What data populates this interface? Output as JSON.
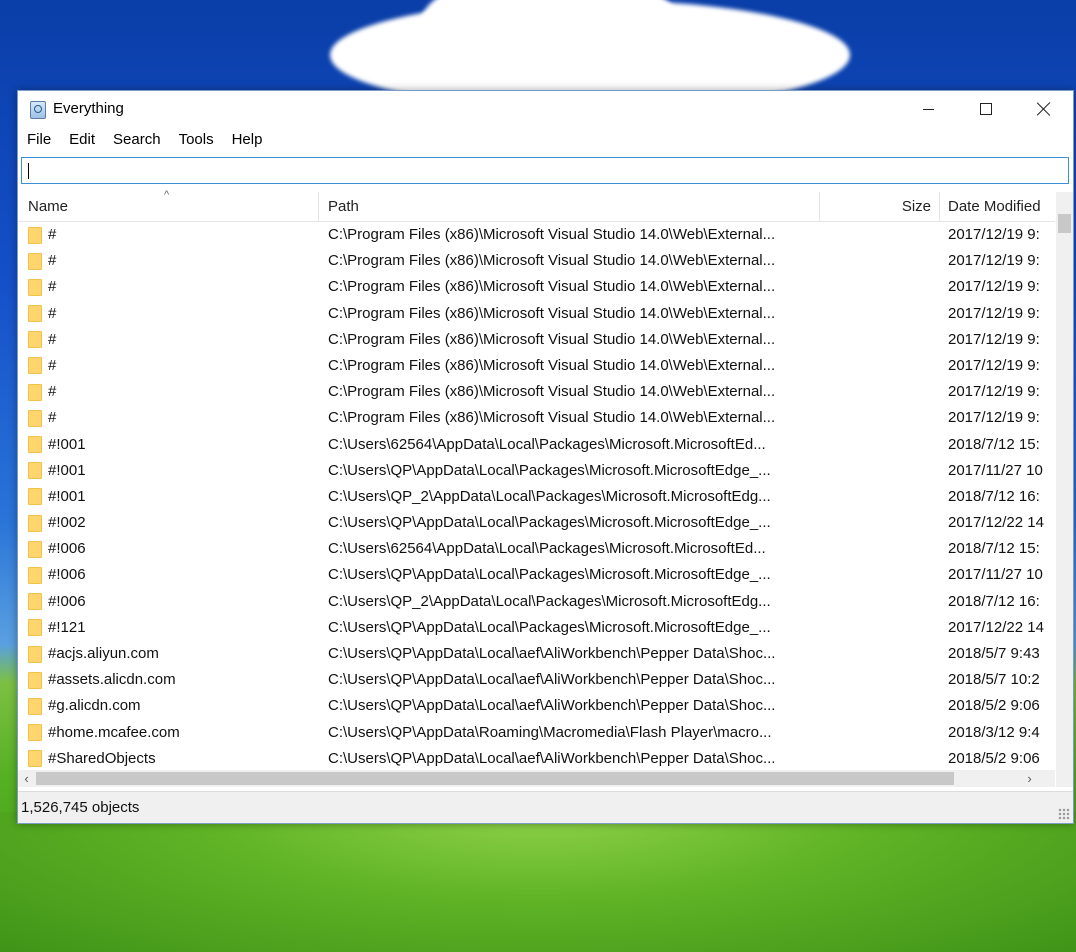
{
  "window": {
    "title": "Everything"
  },
  "menu": [
    "File",
    "Edit",
    "Search",
    "Tools",
    "Help"
  ],
  "search": {
    "value": ""
  },
  "columns": {
    "name": "Name",
    "path": "Path",
    "size": "Size",
    "date": "Date Modified"
  },
  "rows": [
    {
      "name": "#",
      "path": "C:\\Program Files (x86)\\Microsoft Visual Studio 14.0\\Web\\External...",
      "size": "",
      "date": "2017/12/19 9:"
    },
    {
      "name": "#",
      "path": "C:\\Program Files (x86)\\Microsoft Visual Studio 14.0\\Web\\External...",
      "size": "",
      "date": "2017/12/19 9:"
    },
    {
      "name": "#",
      "path": "C:\\Program Files (x86)\\Microsoft Visual Studio 14.0\\Web\\External...",
      "size": "",
      "date": "2017/12/19 9:"
    },
    {
      "name": "#",
      "path": "C:\\Program Files (x86)\\Microsoft Visual Studio 14.0\\Web\\External...",
      "size": "",
      "date": "2017/12/19 9:"
    },
    {
      "name": "#",
      "path": "C:\\Program Files (x86)\\Microsoft Visual Studio 14.0\\Web\\External...",
      "size": "",
      "date": "2017/12/19 9:"
    },
    {
      "name": "#",
      "path": "C:\\Program Files (x86)\\Microsoft Visual Studio 14.0\\Web\\External...",
      "size": "",
      "date": "2017/12/19 9:"
    },
    {
      "name": "#",
      "path": "C:\\Program Files (x86)\\Microsoft Visual Studio 14.0\\Web\\External...",
      "size": "",
      "date": "2017/12/19 9:"
    },
    {
      "name": "#",
      "path": "C:\\Program Files (x86)\\Microsoft Visual Studio 14.0\\Web\\External...",
      "size": "",
      "date": "2017/12/19 9:"
    },
    {
      "name": "#!001",
      "path": "C:\\Users\\62564\\AppData\\Local\\Packages\\Microsoft.MicrosoftEd...",
      "size": "",
      "date": "2018/7/12 15:"
    },
    {
      "name": "#!001",
      "path": "C:\\Users\\QP\\AppData\\Local\\Packages\\Microsoft.MicrosoftEdge_...",
      "size": "",
      "date": "2017/11/27 10"
    },
    {
      "name": "#!001",
      "path": "C:\\Users\\QP_2\\AppData\\Local\\Packages\\Microsoft.MicrosoftEdg...",
      "size": "",
      "date": "2018/7/12 16:"
    },
    {
      "name": "#!002",
      "path": "C:\\Users\\QP\\AppData\\Local\\Packages\\Microsoft.MicrosoftEdge_...",
      "size": "",
      "date": "2017/12/22 14"
    },
    {
      "name": "#!006",
      "path": "C:\\Users\\62564\\AppData\\Local\\Packages\\Microsoft.MicrosoftEd...",
      "size": "",
      "date": "2018/7/12 15:"
    },
    {
      "name": "#!006",
      "path": "C:\\Users\\QP\\AppData\\Local\\Packages\\Microsoft.MicrosoftEdge_...",
      "size": "",
      "date": "2017/11/27 10"
    },
    {
      "name": "#!006",
      "path": "C:\\Users\\QP_2\\AppData\\Local\\Packages\\Microsoft.MicrosoftEdg...",
      "size": "",
      "date": "2018/7/12 16:"
    },
    {
      "name": "#!121",
      "path": "C:\\Users\\QP\\AppData\\Local\\Packages\\Microsoft.MicrosoftEdge_...",
      "size": "",
      "date": "2017/12/22 14"
    },
    {
      "name": "#acjs.aliyun.com",
      "path": "C:\\Users\\QP\\AppData\\Local\\aef\\AliWorkbench\\Pepper Data\\Shoc...",
      "size": "",
      "date": "2018/5/7 9:43"
    },
    {
      "name": "#assets.alicdn.com",
      "path": "C:\\Users\\QP\\AppData\\Local\\aef\\AliWorkbench\\Pepper Data\\Shoc...",
      "size": "",
      "date": "2018/5/7 10:2"
    },
    {
      "name": "#g.alicdn.com",
      "path": "C:\\Users\\QP\\AppData\\Local\\aef\\AliWorkbench\\Pepper Data\\Shoc...",
      "size": "",
      "date": "2018/5/2 9:06"
    },
    {
      "name": "#home.mcafee.com",
      "path": "C:\\Users\\QP\\AppData\\Roaming\\Macromedia\\Flash Player\\macro...",
      "size": "",
      "date": "2018/3/12 9:4"
    },
    {
      "name": "#SharedObjects",
      "path": "C:\\Users\\QP\\AppData\\Local\\aef\\AliWorkbench\\Pepper Data\\Shoc...",
      "size": "",
      "date": "2018/5/2 9:06"
    }
  ],
  "status": {
    "text": "1,526,745 objects"
  },
  "icons": {
    "folder": "folder-icon",
    "app": "everything-app-icon"
  },
  "colors": {
    "folder": "#ffd66e",
    "search_border": "#3b8fd6"
  }
}
